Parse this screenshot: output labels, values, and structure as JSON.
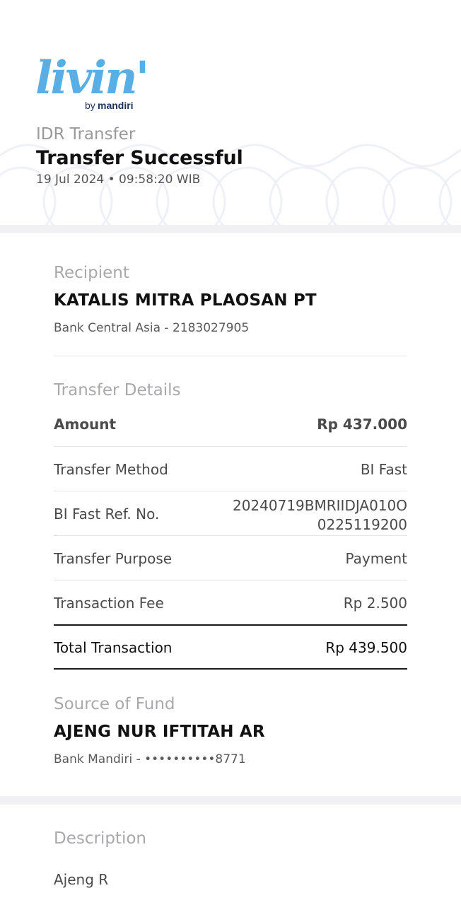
{
  "header": {
    "brand": "livin'",
    "brand_by": "by",
    "brand_bank": "mandiri",
    "eyebrow": "IDR Transfer",
    "title": "Transfer Successful",
    "datetime": "19 Jul 2024 • 09:58:20 WIB"
  },
  "recipient": {
    "label": "Recipient",
    "name": "KATALIS MITRA PLAOSAN PT",
    "account": "Bank Central Asia - 2183027905"
  },
  "transfer_details": {
    "label": "Transfer Details",
    "rows": [
      {
        "label": "Amount",
        "value": "Rp 437.000"
      },
      {
        "label": "Transfer Method",
        "value": "BI Fast"
      },
      {
        "label": "BI Fast Ref. No.",
        "value": "20240719BMRIIDJA010O",
        "value_line2": "0225119200"
      },
      {
        "label": "Transfer Purpose",
        "value": "Payment"
      },
      {
        "label": "Transaction Fee",
        "value": "Rp 2.500"
      }
    ],
    "total": {
      "label": "Total Transaction",
      "value": "Rp 439.500"
    }
  },
  "source_of_fund": {
    "label": "Source of Fund",
    "name": "AJENG NUR IFTITAH AR",
    "account": "Bank Mandiri - ••••••••••8771"
  },
  "description": {
    "label": "Description",
    "value": "Ajeng R"
  },
  "colors": {
    "brand_blue": "#5aaee6",
    "brand_yellow": "#f5b82e",
    "brand_navy": "#1d3461",
    "band": "#f1f1f3"
  }
}
